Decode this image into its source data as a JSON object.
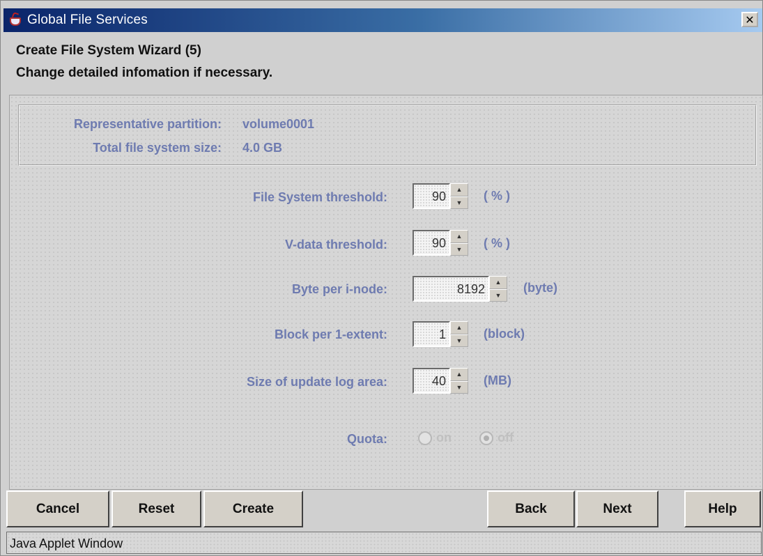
{
  "window": {
    "title": "Global File Services",
    "close_icon": "close-icon"
  },
  "header": {
    "line1": "Create File System Wizard (5)",
    "line2": "Change detailed infomation if necessary."
  },
  "info": {
    "partition_label": "Representative partition:",
    "partition_value": "volume0001",
    "size_label": "Total file system size:",
    "size_value": "4.0 GB"
  },
  "fields": {
    "fs_threshold": {
      "label": "File System threshold:",
      "value": "90",
      "unit": "( % )"
    },
    "vdata_threshold": {
      "label": "V-data threshold:",
      "value": "90",
      "unit": "( % )"
    },
    "byte_per_inode": {
      "label": "Byte per i-node:",
      "value": "8192",
      "unit": "(byte)"
    },
    "block_per_extent": {
      "label": "Block per 1-extent:",
      "value": "1",
      "unit": "(block)"
    },
    "update_log": {
      "label": "Size of update log area:",
      "value": "40",
      "unit": "(MB)"
    }
  },
  "quota": {
    "label": "Quota:",
    "on": "on",
    "off": "off",
    "selected": "off"
  },
  "buttons": {
    "cancel": "Cancel",
    "reset": "Reset",
    "create": "Create",
    "back": "Back",
    "next": "Next",
    "help": "Help"
  },
  "status": {
    "text": "Java Applet Window"
  },
  "colors": {
    "label_text": "#6e7bb0",
    "titlebar_start": "#0a246a"
  }
}
